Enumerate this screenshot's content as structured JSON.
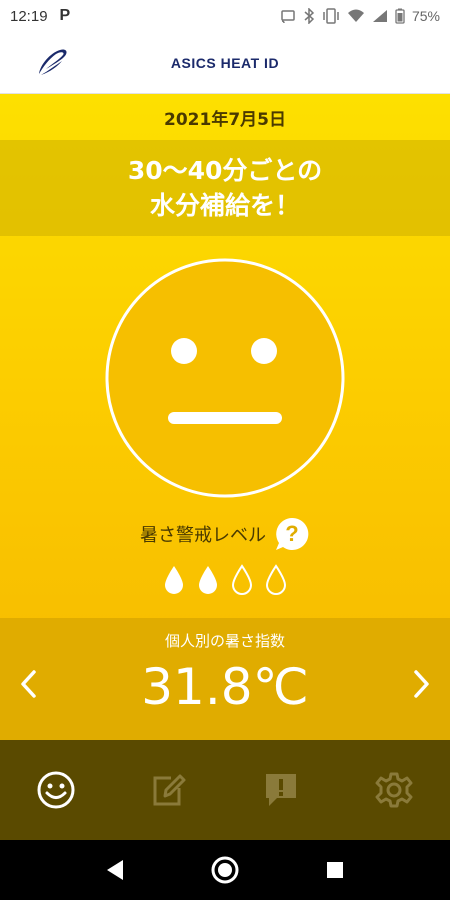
{
  "status_bar": {
    "time": "12:19",
    "notification": "P",
    "battery": "75%"
  },
  "header": {
    "title": "ASICS HEAT ID",
    "logo_icon": "asics-logo"
  },
  "main": {
    "date": "2021年7月5日",
    "advice_line1": "30〜40分ごとの",
    "advice_line2": "水分補給を！",
    "face_icon": "neutral-face",
    "level_label": "暑さ警戒レベル",
    "level_filled": 2,
    "level_total": 4,
    "index_label": "個人別の暑さ指数",
    "index_value": "31.8℃"
  },
  "tabs": [
    {
      "icon": "smiley-icon",
      "active": true
    },
    {
      "icon": "edit-icon",
      "active": false
    },
    {
      "icon": "alert-icon",
      "active": false
    },
    {
      "icon": "gear-icon",
      "active": false
    }
  ],
  "colors": {
    "accent_navy": "#1b2a6b",
    "background_yellow": "#fccd00",
    "tab_bar": "#5a4a00"
  }
}
